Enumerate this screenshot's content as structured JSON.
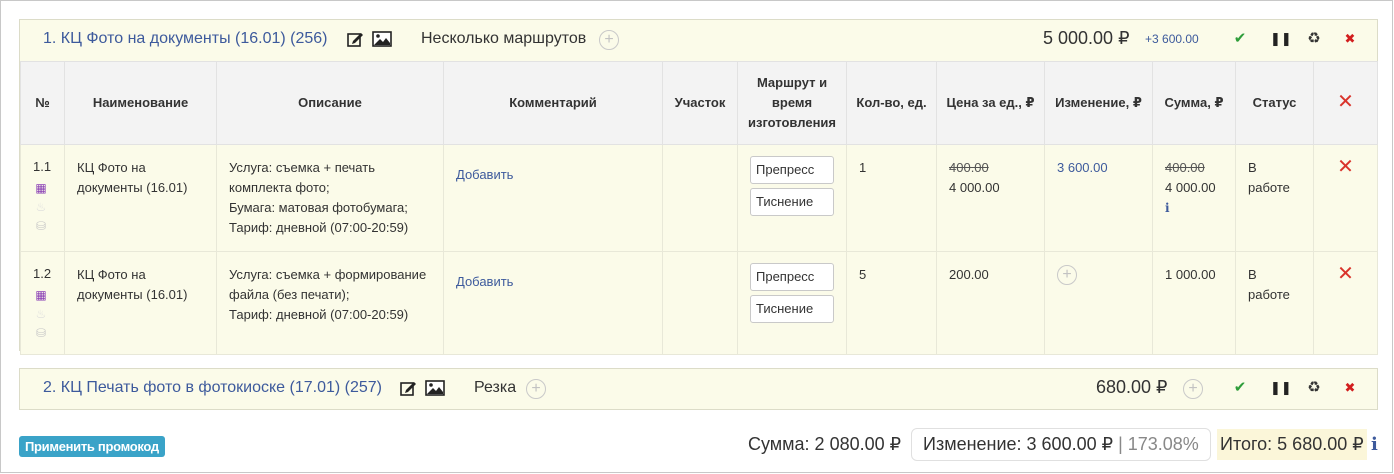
{
  "orders": [
    {
      "title": "1. КЦ Фото на документы (16.01) (256)",
      "route_label": "Несколько маршрутов",
      "sum": "5 000.00 ₽",
      "change": "+3 600.00"
    },
    {
      "title": "2. КЦ Печать фото в фотокиоске (17.01) (257)",
      "route_label": "Резка",
      "sum": "680.00 ₽"
    }
  ],
  "table": {
    "headers": {
      "num": "№",
      "name": "Наименование",
      "description": "Описание",
      "comment": "Комментарий",
      "site": "Участок",
      "route": "Маршрут и время изготовления",
      "qty": "Кол-во, ед.",
      "price": "Цена за ед., ₽",
      "change": "Изменение, ₽",
      "sum": "Сумма, ₽",
      "status": "Статус"
    },
    "rows": [
      {
        "num": "1.1",
        "name": "КЦ Фото на документы (16.01)",
        "desc1": "Услуга: съемка + печать комплекта фото;",
        "desc2": "Бумага: матовая фотобумага;",
        "desc3": "Тариф: дневной (07:00-20:59)",
        "comment_link": "Добавить",
        "route1": "Препресс",
        "route2": "Тиснение",
        "qty": "1",
        "price_old": "400.00",
        "price_new": "4 000.00",
        "change": "3 600.00",
        "sum_old": "400.00",
        "sum_new": "4 000.00",
        "status": "В работе"
      },
      {
        "num": "1.2",
        "name": "КЦ Фото на документы (16.01)",
        "desc1": "Услуга: съемка + формирование файла (без печати);",
        "desc2": "Тариф: дневной (07:00-20:59)",
        "comment_link": "Добавить",
        "route1": "Препресс",
        "route2": "Тиснение",
        "qty": "5",
        "price": "200.00",
        "sum": "1 000.00",
        "status": "В работе"
      }
    ]
  },
  "footer": {
    "promo_button": "Применить промокод",
    "sum": "Сумма: 2 080.00 ₽",
    "change": "Изменение: 3 600.00 ₽",
    "change_sep": " | ",
    "change_pct": "173.08%",
    "total": "Итого: 5 680.00 ₽"
  },
  "colors": {
    "accent_link": "#3d5a9c",
    "order_bg": "#fbfbe9",
    "promo_button": "#3aa3c8",
    "delete": "#d9332b",
    "confirm": "#2e9d3a"
  },
  "icons": {
    "edit": "edit-icon",
    "image": "image-icon",
    "add": "add-circle-icon",
    "confirm": "check-icon",
    "pause": "pause-icon",
    "recycle": "recycle-icon",
    "delete": "close-icon",
    "calc": "calculator-icon",
    "fire": "fire-icon",
    "coins": "coins-icon",
    "info": "info-icon"
  }
}
